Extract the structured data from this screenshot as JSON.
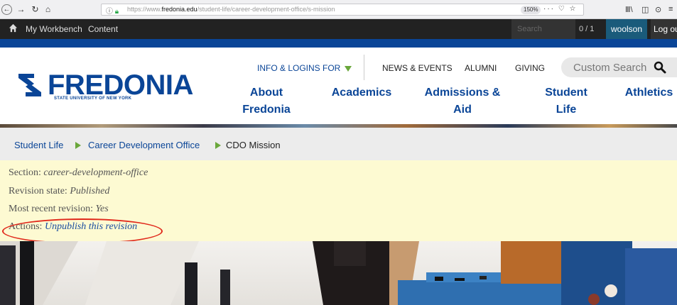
{
  "browser": {
    "url_prefix": "https://www.",
    "url_host": "fredonia.edu",
    "url_path": "/student-life/career-development-office/s-mission",
    "zoom": "150%",
    "url_actions": "··· ♡ ☆"
  },
  "admin_toolbar": {
    "items": [
      "My Workbench",
      "Content"
    ],
    "search_placeholder": "Search",
    "count": "0 / 1",
    "user": "woolson",
    "logout": "Log out"
  },
  "header": {
    "logo_text": "FREDONIA",
    "logo_subtext": "STATE UNIVERSITY OF NEW YORK",
    "utility": {
      "info": "INFO & LOGINS FOR",
      "links": [
        "NEWS & EVENTS",
        "ALUMNI",
        "GIVING"
      ]
    },
    "search_placeholder": "Custom Search",
    "nav": [
      {
        "line1": "About",
        "line2": "Fredonia"
      },
      {
        "line1": "Academics",
        "line2": ""
      },
      {
        "line1": "Admissions &",
        "line2": "Aid"
      },
      {
        "line1": "Student",
        "line2": "Life"
      },
      {
        "line1": "Athletics",
        "line2": ""
      }
    ]
  },
  "breadcrumb": {
    "items": [
      "Student Life",
      "Career Development Office"
    ],
    "current": "CDO Mission"
  },
  "revision": {
    "section_label": "Section:",
    "section_value": "career-development-office",
    "state_label": "Revision state:",
    "state_value": "Published",
    "recent_label": "Most recent revision:",
    "recent_value": "Yes",
    "actions_label": "Actions:",
    "actions_link": "Unpublish this revision"
  },
  "colors": {
    "brand_blue": "#0a4597",
    "accent_green": "#6aa73b",
    "highlight_red": "#e0281b",
    "revision_bg": "#fdfad2"
  }
}
